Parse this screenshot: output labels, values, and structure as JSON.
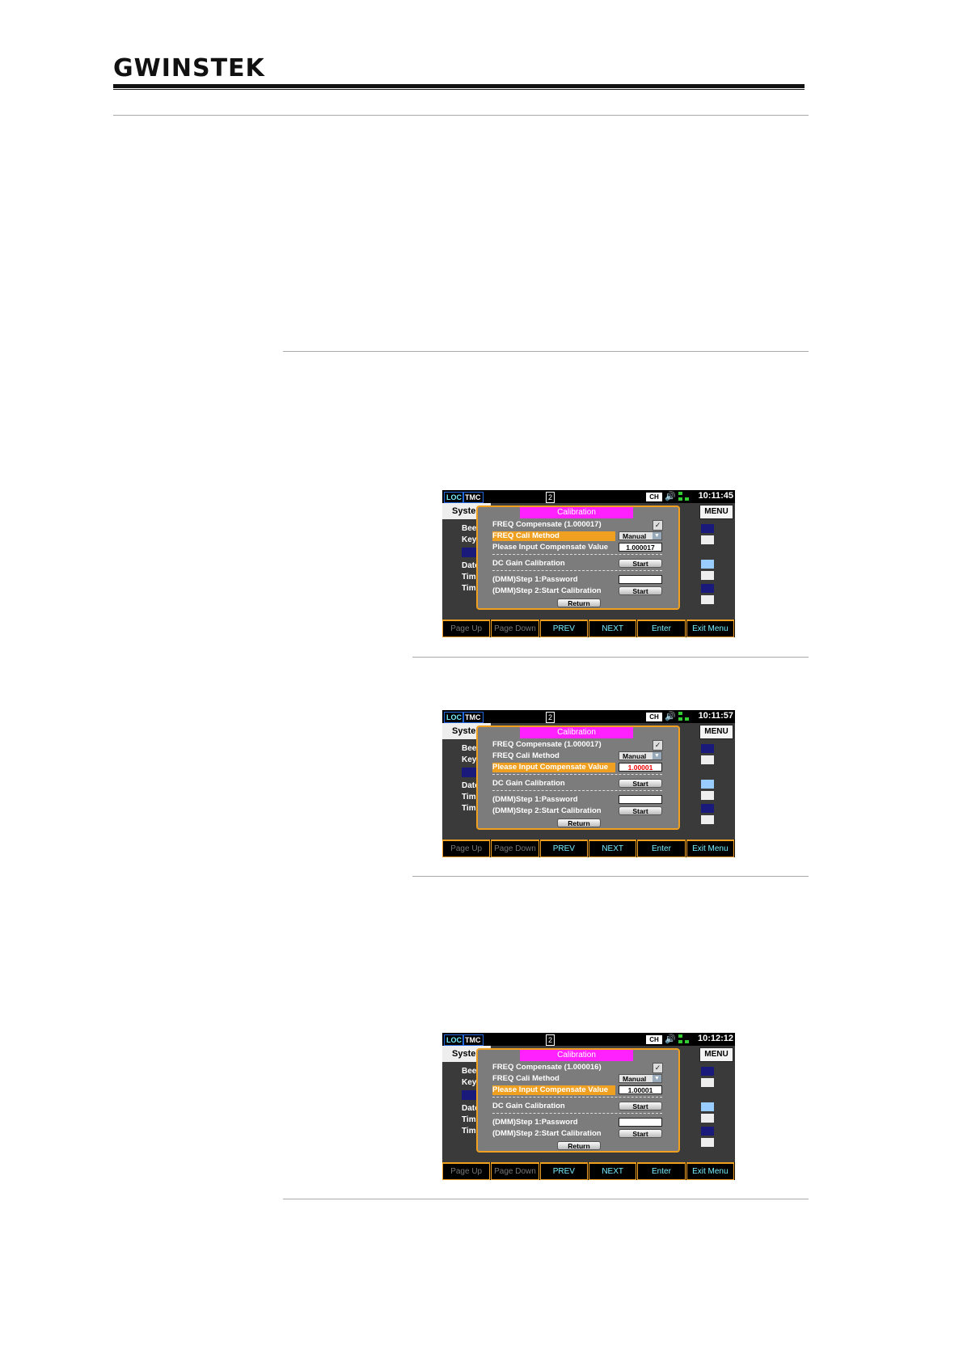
{
  "header": {
    "logo_text": "GWINSTEK"
  },
  "screens": [
    {
      "status": {
        "loc": "LOC",
        "tmc": "TMC",
        "page": "2",
        "ch": "CH",
        "time": "10:11:45"
      },
      "tab": "Syster",
      "menu_label": "MENU",
      "bg_labels": [
        "Bee",
        "Key",
        "Date",
        "Tim",
        "Tim"
      ],
      "dialog": {
        "title": "Calibration",
        "freq_compensate": "FREQ Compensate (1.000017)",
        "freq_cali_method": "FREQ Cali Method",
        "method_value": "Manual",
        "compensate_label": "Please Input Compensate Value",
        "compensate_value": "1.000017",
        "dc_gain": "DC Gain Calibration",
        "start": "Start",
        "step1": "(DMM)Step 1:Password",
        "step2": "(DMM)Step 2:Start Calibration",
        "return": "Return"
      },
      "fkeys": [
        "Page Up",
        "Page Down",
        "PREV",
        "NEXT",
        "Enter",
        "Exit Menu"
      ]
    },
    {
      "status": {
        "loc": "LOC",
        "tmc": "TMC",
        "page": "2",
        "ch": "CH",
        "time": "10:11:57"
      },
      "tab": "Syster",
      "menu_label": "MENU",
      "bg_labels": [
        "Bee",
        "Key",
        "Date",
        "Tim",
        "Tim"
      ],
      "dialog": {
        "title": "Calibration",
        "freq_compensate": "FREQ Compensate (1.000017)",
        "freq_cali_method": "FREQ Cali Method",
        "method_value": "Manual",
        "compensate_label": "Please Input Compensate Value",
        "compensate_value": "1.00001",
        "dc_gain": "DC Gain Calibration",
        "start": "Start",
        "step1": "(DMM)Step 1:Password",
        "step2": "(DMM)Step 2:Start Calibration",
        "return": "Return"
      },
      "fkeys": [
        "Page Up",
        "Page Down",
        "PREV",
        "NEXT",
        "Enter",
        "Exit Menu"
      ]
    },
    {
      "status": {
        "loc": "LOC",
        "tmc": "TMC",
        "page": "2",
        "ch": "CH",
        "time": "10:12:12"
      },
      "tab": "Syster",
      "menu_label": "MENU",
      "bg_labels": [
        "Bee",
        "Key",
        "Date",
        "Tim",
        "Tim"
      ],
      "dialog": {
        "title": "Calibration",
        "freq_compensate": "FREQ Compensate (1.000016)",
        "freq_cali_method": "FREQ Cali Method",
        "method_value": "Manual",
        "compensate_label": "Please Input Compensate Value",
        "compensate_value": "1.00001",
        "dc_gain": "DC Gain Calibration",
        "start": "Start",
        "step1": "(DMM)Step 1:Password",
        "step2": "(DMM)Step 2:Start Calibration",
        "return": "Return"
      },
      "fkeys": [
        "Page Up",
        "Page Down",
        "PREV",
        "NEXT",
        "Enter",
        "Exit Menu"
      ]
    }
  ]
}
